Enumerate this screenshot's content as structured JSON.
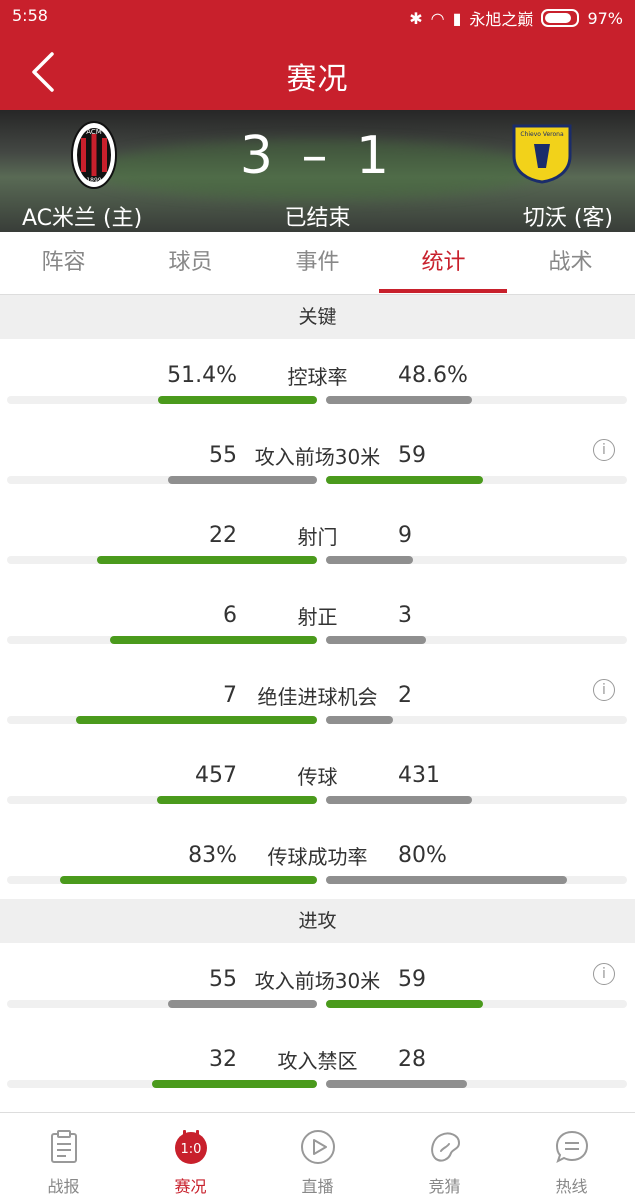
{
  "status_bar": {
    "time": "5:58",
    "carrier": "永旭之巅",
    "battery": "97%"
  },
  "header": {
    "title": "赛况"
  },
  "match": {
    "home_team": "AC米兰 (主)",
    "away_team": "切沃 (客)",
    "score": "3 – 1",
    "status": "已结束",
    "home_crest_text": [
      "ACM",
      "1899"
    ],
    "away_crest_text": "Chievo Verona"
  },
  "tabs": [
    "阵容",
    "球员",
    "事件",
    "统计",
    "战术"
  ],
  "active_tab": "统计",
  "sections": [
    {
      "title": "关键",
      "stats": [
        {
          "label": "控球率",
          "home": "51.4%",
          "away": "48.6%",
          "home_share": 0.514,
          "away_share": 0.486,
          "home_leads": true,
          "info": false
        },
        {
          "label": "攻入前场30米",
          "home": "55",
          "away": "59",
          "home_share": 0.48,
          "away_share": 0.52,
          "home_leads": false,
          "info": true
        },
        {
          "label": "射门",
          "home": "22",
          "away": "9",
          "home_share": 0.71,
          "away_share": 0.29,
          "home_leads": true,
          "info": false
        },
        {
          "label": "射正",
          "home": "6",
          "away": "3",
          "home_share": 0.667,
          "away_share": 0.333,
          "home_leads": true,
          "info": false
        },
        {
          "label": "绝佳进球机会",
          "home": "7",
          "away": "2",
          "home_share": 0.778,
          "away_share": 0.222,
          "home_leads": true,
          "info": true
        },
        {
          "label": "传球",
          "home": "457",
          "away": "431",
          "home_share": 0.515,
          "away_share": 0.485,
          "home_leads": true,
          "info": false
        },
        {
          "label": "传球成功率",
          "home": "83%",
          "away": "80%",
          "home_share": 0.83,
          "away_share": 0.8,
          "home_leads": true,
          "info": false
        }
      ]
    },
    {
      "title": "进攻",
      "stats": [
        {
          "label": "攻入前场30米",
          "home": "55",
          "away": "59",
          "home_share": 0.48,
          "away_share": 0.52,
          "home_leads": false,
          "info": true
        },
        {
          "label": "攻入禁区",
          "home": "32",
          "away": "28",
          "home_share": 0.533,
          "away_share": 0.467,
          "home_leads": true,
          "info": false
        }
      ]
    }
  ],
  "bottom_nav": [
    {
      "label": "战报",
      "icon": "report-icon"
    },
    {
      "label": "赛况",
      "icon": "score-badge-icon",
      "badge": "1:0"
    },
    {
      "label": "直播",
      "icon": "play-icon"
    },
    {
      "label": "竞猜",
      "icon": "bean-icon"
    },
    {
      "label": "热线",
      "icon": "chat-icon"
    }
  ],
  "active_nav": "赛况",
  "colors": {
    "brand": "#c8202c",
    "leader_bar": "#4a9a1c",
    "other_bar": "#8f8f8f"
  }
}
